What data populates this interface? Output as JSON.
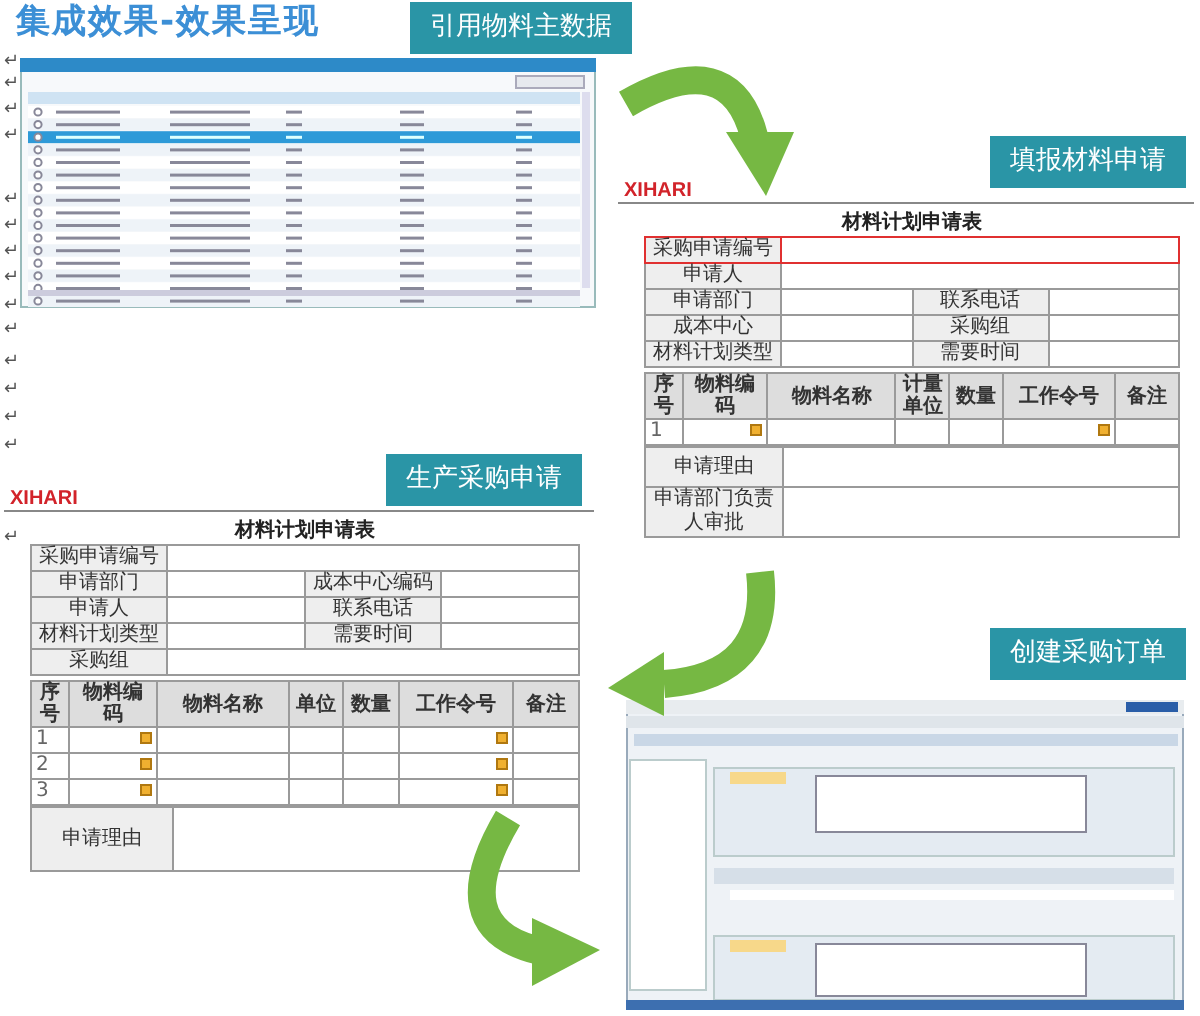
{
  "title": "集成效果-效果呈现",
  "steps": [
    {
      "label": "引用物料主数据"
    },
    {
      "label": "填报材料申请"
    },
    {
      "label": "生产采购申请"
    },
    {
      "label": "创建采购订单"
    }
  ],
  "paragraph_marks": [
    "↵",
    "↵",
    "↵",
    "↵",
    "↵",
    "↵",
    "↵",
    "↵",
    "↵",
    "↵",
    "↵",
    "↵",
    "↵",
    "↵",
    "↵"
  ],
  "forms": [
    {
      "logo": "XIHARI",
      "heading": "材料计划申请表",
      "fields": [
        {
          "highlighted": true,
          "cells": [
            "采购申请编号"
          ]
        },
        {
          "highlighted": false,
          "cells": [
            "申请人"
          ]
        },
        {
          "highlighted": false,
          "cells": [
            "申请部门",
            "联系电话"
          ]
        },
        {
          "highlighted": false,
          "cells": [
            "成本中心",
            "采购组"
          ]
        },
        {
          "highlighted": false,
          "cells": [
            "材料计划类型",
            "需要时间"
          ]
        }
      ],
      "columns": [
        "序号",
        "物料编码",
        "物料名称",
        "计量单位",
        "数量",
        "工作令号",
        "备注"
      ],
      "rows": [
        {
          "no": "1"
        }
      ],
      "footer": [
        "申请理由",
        "申请部门负责人审批"
      ]
    },
    {
      "logo": "XIHARI",
      "heading": "材料计划申请表",
      "fields": [
        {
          "highlighted": false,
          "cells": [
            "采购申请编号"
          ]
        },
        {
          "highlighted": false,
          "cells": [
            "申请部门",
            "成本中心编码"
          ]
        },
        {
          "highlighted": false,
          "cells": [
            "申请人",
            "联系电话"
          ]
        },
        {
          "highlighted": false,
          "cells": [
            "材料计划类型",
            "需要时间"
          ]
        },
        {
          "highlighted": false,
          "cells": [
            "采购组"
          ]
        }
      ],
      "columns": [
        "序号",
        "物料编码",
        "物料名称",
        "单位",
        "数量",
        "工作令号",
        "备注"
      ],
      "rows": [
        {
          "no": "1"
        },
        {
          "no": "2"
        },
        {
          "no": "3"
        }
      ],
      "footer": [
        "申请理由"
      ]
    }
  ]
}
